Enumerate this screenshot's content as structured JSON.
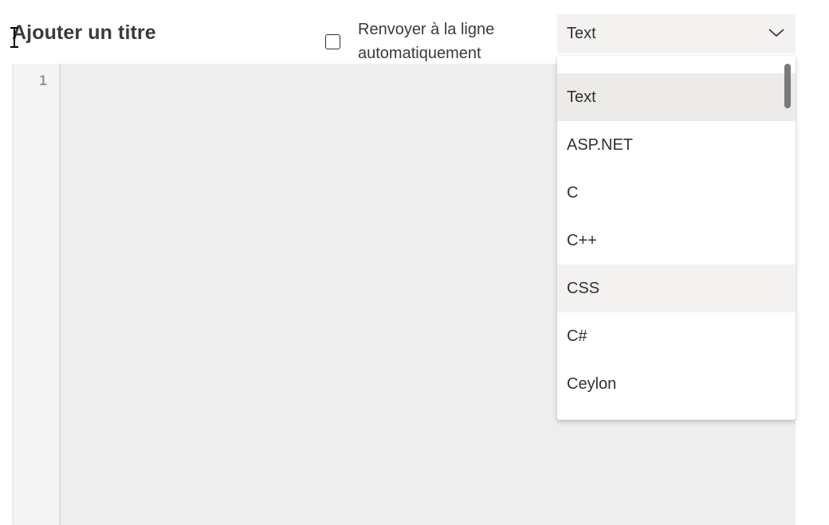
{
  "header": {
    "title_placeholder": "Ajouter un titre"
  },
  "wrap_option": {
    "label": "Renvoyer à la ligne automatiquement",
    "checked": false
  },
  "language_select": {
    "selected": "Text",
    "icon": "chevron-down-icon",
    "options": [
      {
        "label": "Text",
        "state": "selected"
      },
      {
        "label": "ASP.NET",
        "state": "normal"
      },
      {
        "label": "C",
        "state": "normal"
      },
      {
        "label": "C++",
        "state": "normal"
      },
      {
        "label": "CSS",
        "state": "hovered"
      },
      {
        "label": "C#",
        "state": "normal"
      },
      {
        "label": "Ceylon",
        "state": "normal"
      }
    ]
  },
  "editor": {
    "line_numbers": [
      "1"
    ],
    "content": ""
  },
  "colors": {
    "selected_option_bg": "#edebe9",
    "hovered_option_bg": "#f3f2f1",
    "select_bg": "#f3f2f1",
    "editor_bg": "#eeeeee",
    "text": "#323130"
  }
}
